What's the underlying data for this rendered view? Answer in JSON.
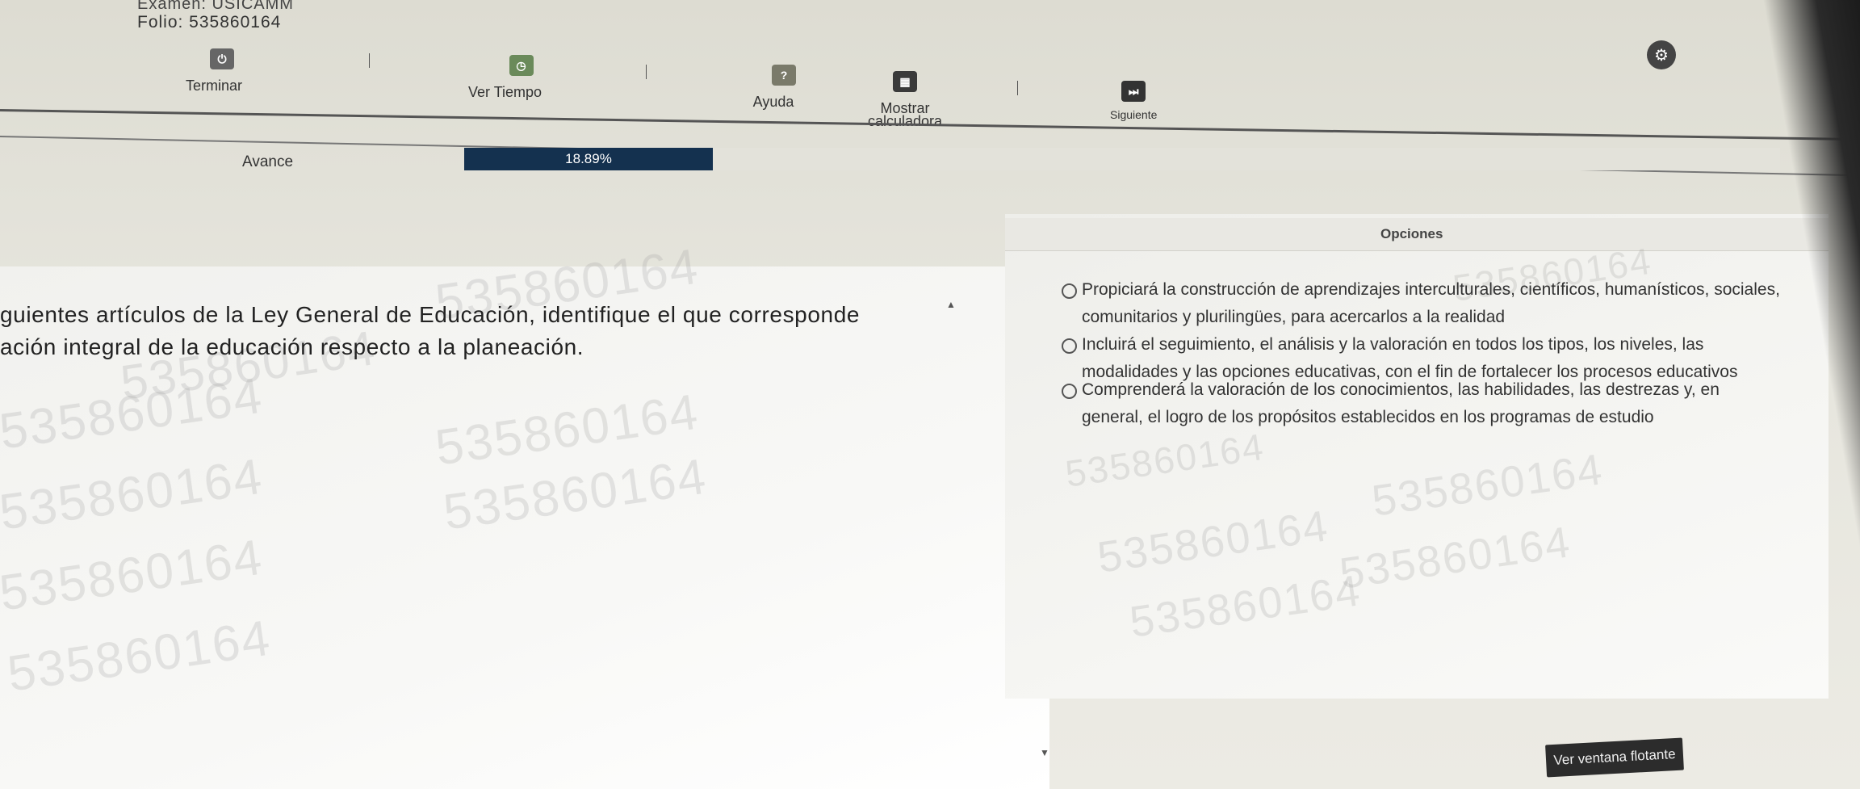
{
  "header": {
    "exam_label": "Examen: USICAMM",
    "folio": "Folio: 535860164"
  },
  "toolbar": {
    "terminar": "Terminar",
    "ver_tiempo": "Ver Tiempo",
    "ayuda": "Ayuda",
    "mostrar_calculadora_line1": "Mostrar",
    "mostrar_calculadora_line2": "calculadora",
    "siguiente": "Siguiente"
  },
  "progress": {
    "label": "Avance",
    "value_text": "18.89%",
    "value": 18.89
  },
  "question": {
    "line1": "guientes artículos de la Ley General de Educación, identifique el que corresponde",
    "line2": "ación integral de la educación respecto a la planeación."
  },
  "options": {
    "title": "Opciones",
    "items": [
      {
        "text": "Propiciará la construcción de aprendizajes interculturales, científicos, humanísticos, sociales, comunitarios y plurilingües, para acercarlos a la realidad"
      },
      {
        "text": "Incluirá el seguimiento, el análisis y la valoración en todos los tipos, los niveles, las modalidades y las opciones educativas, con el fin de fortalecer los procesos educativos"
      },
      {
        "text": "Comprenderá la valoración de los conocimientos, las habilidades, las destrezas y, en general, el logro de los propósitos establecidos en los programas de estudio"
      }
    ]
  },
  "watermark": "535860164",
  "floating_window_button": "Ver ventana flotante",
  "colors": {
    "progress_fill": "#14314f",
    "float_button": "#2c2c2c"
  }
}
